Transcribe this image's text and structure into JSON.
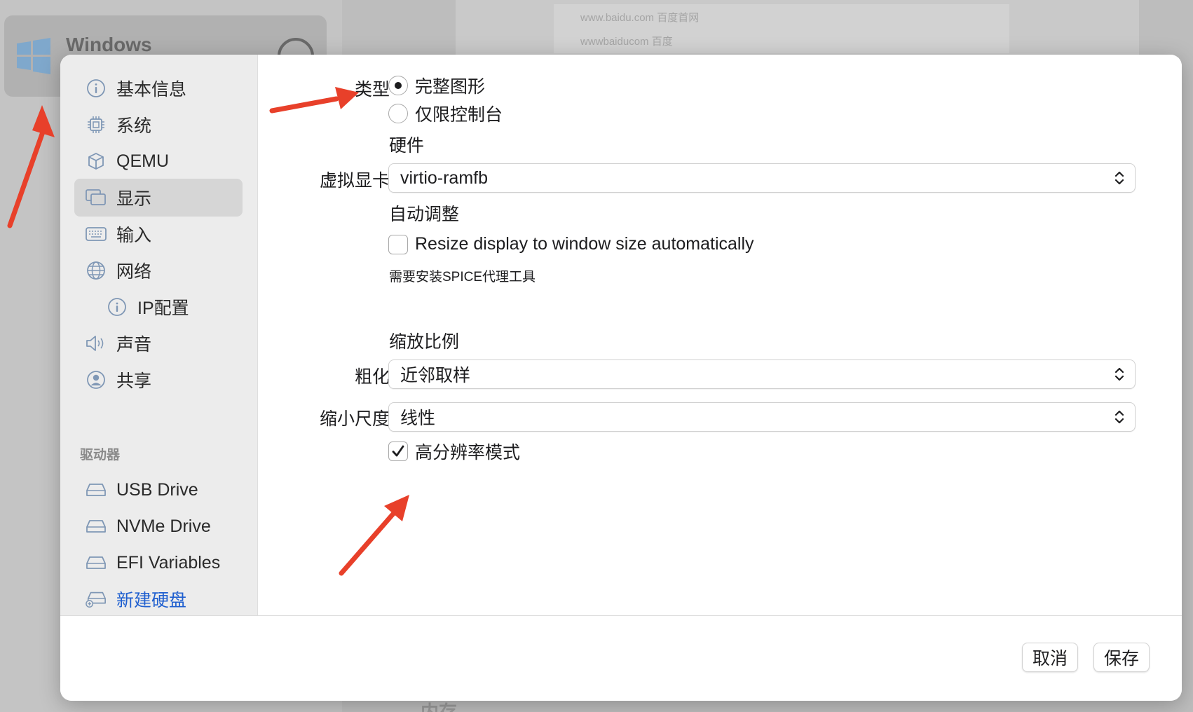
{
  "background": {
    "vm_name": "Windows",
    "url_line_1": "www.baidu.com 百度首网",
    "url_line_2": "wwwbaiducom 百度",
    "bottom_text": "内存"
  },
  "sidebar": {
    "items": [
      {
        "label": "基本信息",
        "icon": "info-icon"
      },
      {
        "label": "系统",
        "icon": "cpu-icon"
      },
      {
        "label": "QEMU",
        "icon": "cube-icon"
      },
      {
        "label": "显示",
        "icon": "display-icon",
        "selected": true
      },
      {
        "label": "输入",
        "icon": "keyboard-icon"
      },
      {
        "label": "网络",
        "icon": "globe-icon"
      },
      {
        "label": "IP配置",
        "icon": "ip-icon"
      },
      {
        "label": "声音",
        "icon": "speaker-icon"
      },
      {
        "label": "共享",
        "icon": "person-icon"
      }
    ],
    "drives_header": "驱动器",
    "drives": [
      {
        "label": "USB Drive",
        "icon": "drive-icon"
      },
      {
        "label": "NVMe Drive",
        "icon": "drive-icon"
      },
      {
        "label": "EFI Variables",
        "icon": "drive-icon"
      },
      {
        "label": "新建硬盘",
        "icon": "new-drive-icon"
      }
    ]
  },
  "display": {
    "type_label": "类型",
    "type_options": [
      "完整图形",
      "仅限控制台"
    ],
    "type_selected": "完整图形",
    "hardware_header": "硬件",
    "gpu_label": "虚拟显卡",
    "gpu_value": "virtio-ramfb",
    "auto_adjust_header": "自动调整",
    "resize_checkbox_label": "Resize display to window size automatically",
    "resize_checked": false,
    "spice_note": "需要安装SPICE代理工具",
    "scaling_header": "缩放比例",
    "upscale_label": "粗化",
    "upscale_value": "近邻取样",
    "downscale_label": "缩小尺度",
    "downscale_value": "线性",
    "retina_label": "高分辨率模式",
    "retina_checked": true
  },
  "footer": {
    "cancel_label": "取消",
    "save_label": "保存"
  },
  "colors": {
    "accent_link": "#1f5fcf",
    "annotation_arrow": "#e8402a",
    "sidebar_bg": "#ececec",
    "selected_bg": "#d6d6d6"
  }
}
